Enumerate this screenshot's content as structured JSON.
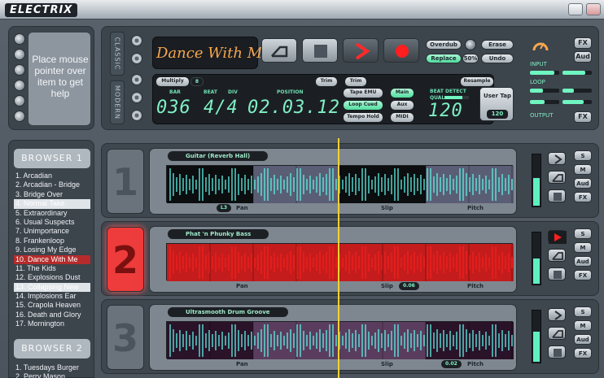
{
  "app": {
    "logo": "ELECTRIX"
  },
  "help": {
    "text": "Place mouse pointer over item to get help"
  },
  "transport": {
    "tab_classic": "CLASSIC",
    "tab_modern": "MODERN",
    "song_title": "Dance With Me",
    "overdub": "Overdub",
    "erase": "Erase",
    "replace": "Replace",
    "undo": "Undo",
    "feedback_value": "50%",
    "multiply": "Multiply",
    "multiply_value": "8",
    "trim_left": "Trim",
    "trim_right": "Trim",
    "resample": "Resample",
    "bar_label": "BAR",
    "beat_label": "BEAT",
    "div_label": "DIV",
    "position_label": "POSITION",
    "bar_value": "036",
    "div_value": "4/4",
    "position_value": "02.03.12",
    "tape_emu": "Tape EMU",
    "loop_cued": "Loop Cued",
    "tempo_hold": "Tempo Hold",
    "main": "Main",
    "aux": "Aux",
    "midi": "MIDI",
    "beat_detect": "BEAT DETECT",
    "qual": "QUAL",
    "bpm_value": "120",
    "user_tap": "User Tap",
    "user_tap_value": "120",
    "input_label": "INPUT",
    "loop_label": "LOOP",
    "output_label": "OUTPUT",
    "fx": "FX",
    "aud": "Aud",
    "fx_out": "FX",
    "accent_color": "#7ff0c4",
    "orange_color": "#f6a64e"
  },
  "browser1": {
    "title": "BROWSER 1",
    "items": [
      "1. Arcadian",
      "2. Arcadian - Bridge",
      "3. Bridge Over",
      "4. Normal Take",
      "5. Extraordinary",
      "6. Usual Suspects",
      "7. Unimportance",
      "8. Frankenloop",
      "9. Losing My Edge",
      "10. Dance With Me",
      "11. The Kids",
      "12. Explosions Dust",
      "13. Collapsing New",
      "14. Implosions Ear",
      "15. Crapola Heaven",
      "16. Death and Glory",
      "17. Mornington"
    ]
  },
  "browser2": {
    "title": "BROWSER 2",
    "items": [
      "1. Tuesdays Burger",
      "2. Perry Mason"
    ]
  },
  "decks": [
    {
      "number": "1",
      "name": "Guitar (Reverb Hall)",
      "pan_value": "L3",
      "pan": "Pan",
      "slip": "Slip",
      "slip_value": "",
      "pitch": "Pitch",
      "pitch_value": "",
      "s": "S",
      "m": "M",
      "aud": "Aud",
      "fx": "FX",
      "level": 0.55
    },
    {
      "number": "2",
      "name": "Phat 'n Phunky Bass",
      "pan_value": "",
      "pan": "Pan",
      "slip": "Slip",
      "slip_value": "0.06",
      "pitch": "Pitch",
      "pitch_value": "",
      "s": "S",
      "m": "M",
      "aud": "Aud",
      "fx": "FX",
      "level": 0.5
    },
    {
      "number": "3",
      "name": "Ultrasmooth Drum Groove",
      "pan_value": "",
      "pan": "Pan",
      "slip": "Slip",
      "slip_value": "",
      "pitch": "Pitch",
      "pitch_value": "0.02",
      "s": "S",
      "m": "M",
      "aud": "Aud",
      "fx": "FX",
      "level": 0.6
    }
  ]
}
